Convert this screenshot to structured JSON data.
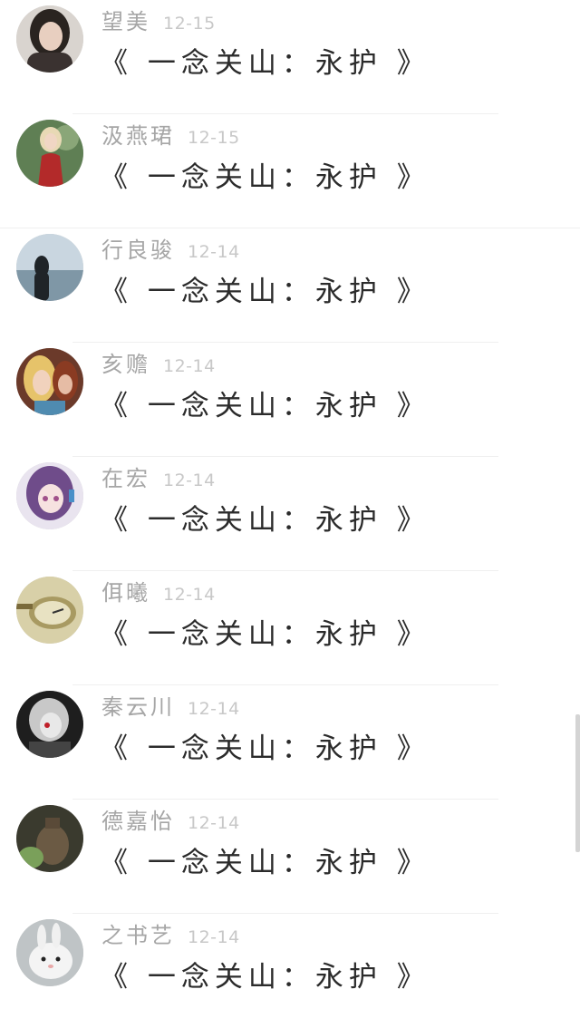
{
  "items": [
    {
      "name": "望美",
      "date": "12-15",
      "message": "《 一念关山：永护 》",
      "avatar": "woman-portrait-avatar"
    },
    {
      "name": "汲燕珺",
      "date": "12-15",
      "message": "《 一念关山：永护 》",
      "avatar": "woman-red-dress-avatar"
    },
    {
      "name": "行良骏",
      "date": "12-14",
      "message": "《 一念关山：永护 》",
      "avatar": "seaside-silhouette-avatar"
    },
    {
      "name": "亥赡",
      "date": "12-14",
      "message": "《 一念关山：永护 》",
      "avatar": "illustrated-women-avatar"
    },
    {
      "name": "在宏",
      "date": "12-14",
      "message": "《 一念关山：永护 》",
      "avatar": "anime-girl-avatar"
    },
    {
      "name": "佴曦",
      "date": "12-14",
      "message": "《 一念关山：永护 》",
      "avatar": "old-watch-avatar"
    },
    {
      "name": "秦云川",
      "date": "12-14",
      "message": "《 一念关山：永护 》",
      "avatar": "dark-anime-avatar"
    },
    {
      "name": "德嘉怡",
      "date": "12-14",
      "message": "《 一念关山：永护 》",
      "avatar": "pottery-vase-avatar"
    },
    {
      "name": "之书艺",
      "date": "12-14",
      "message": "《 一念关山：永护 》",
      "avatar": "white-rabbit-avatar"
    }
  ]
}
